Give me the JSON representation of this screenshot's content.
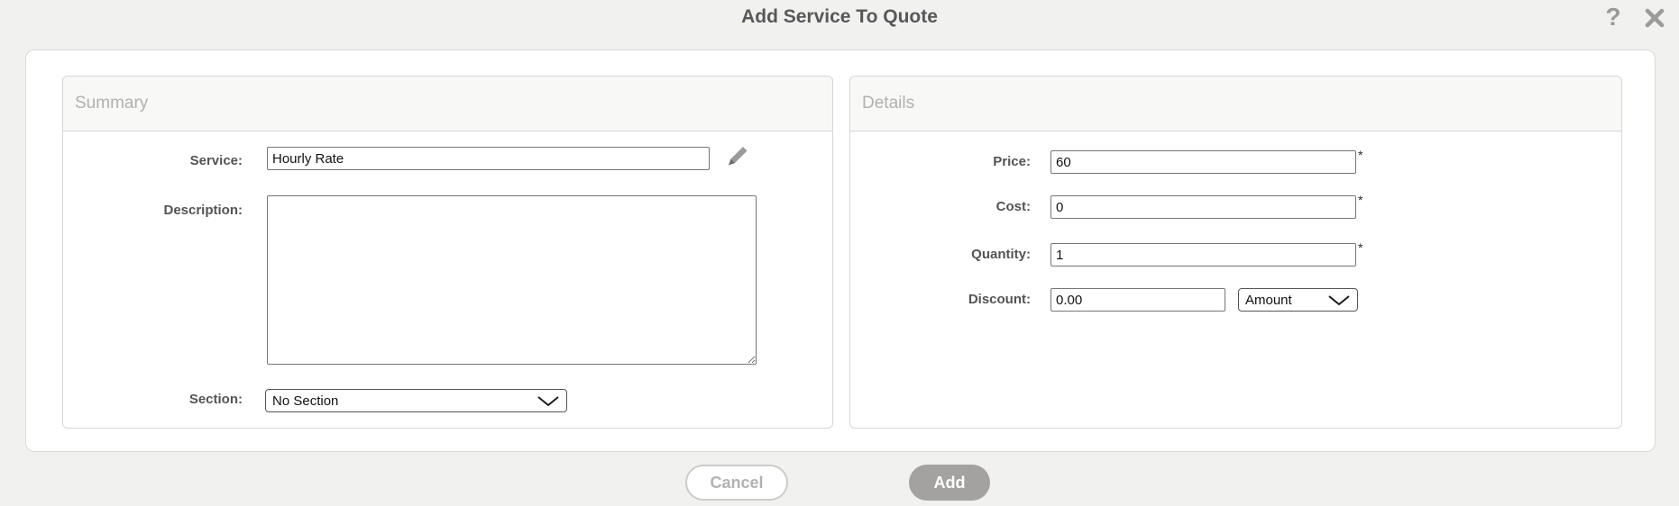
{
  "dialog": {
    "title": "Add Service To Quote",
    "help_icon": "?"
  },
  "summary": {
    "header": "Summary",
    "service_label": "Service:",
    "service_value": "Hourly Rate",
    "description_label": "Description:",
    "description_value": "",
    "section_label": "Section:",
    "section_value": "No Section"
  },
  "details": {
    "header": "Details",
    "required_marker": "*",
    "price_label": "Price:",
    "price_value": "60",
    "cost_label": "Cost:",
    "cost_value": "0",
    "quantity_label": "Quantity:",
    "quantity_value": "1",
    "discount_label": "Discount:",
    "discount_value": "0.00",
    "discount_type_value": "Amount"
  },
  "footer": {
    "cancel_label": "Cancel",
    "add_label": "Add"
  },
  "colors": {
    "page_background": "#f1f1ef",
    "card_background": "#ffffff",
    "panel_header_background": "#f8f8f6",
    "panel_header_text": "#b2b1b0",
    "title_text": "#58585a",
    "label_text": "#545456",
    "icon_gray": "#9b9b9b",
    "add_button_background": "#a3a2a1",
    "cancel_button_text": "#b3b2b1"
  }
}
